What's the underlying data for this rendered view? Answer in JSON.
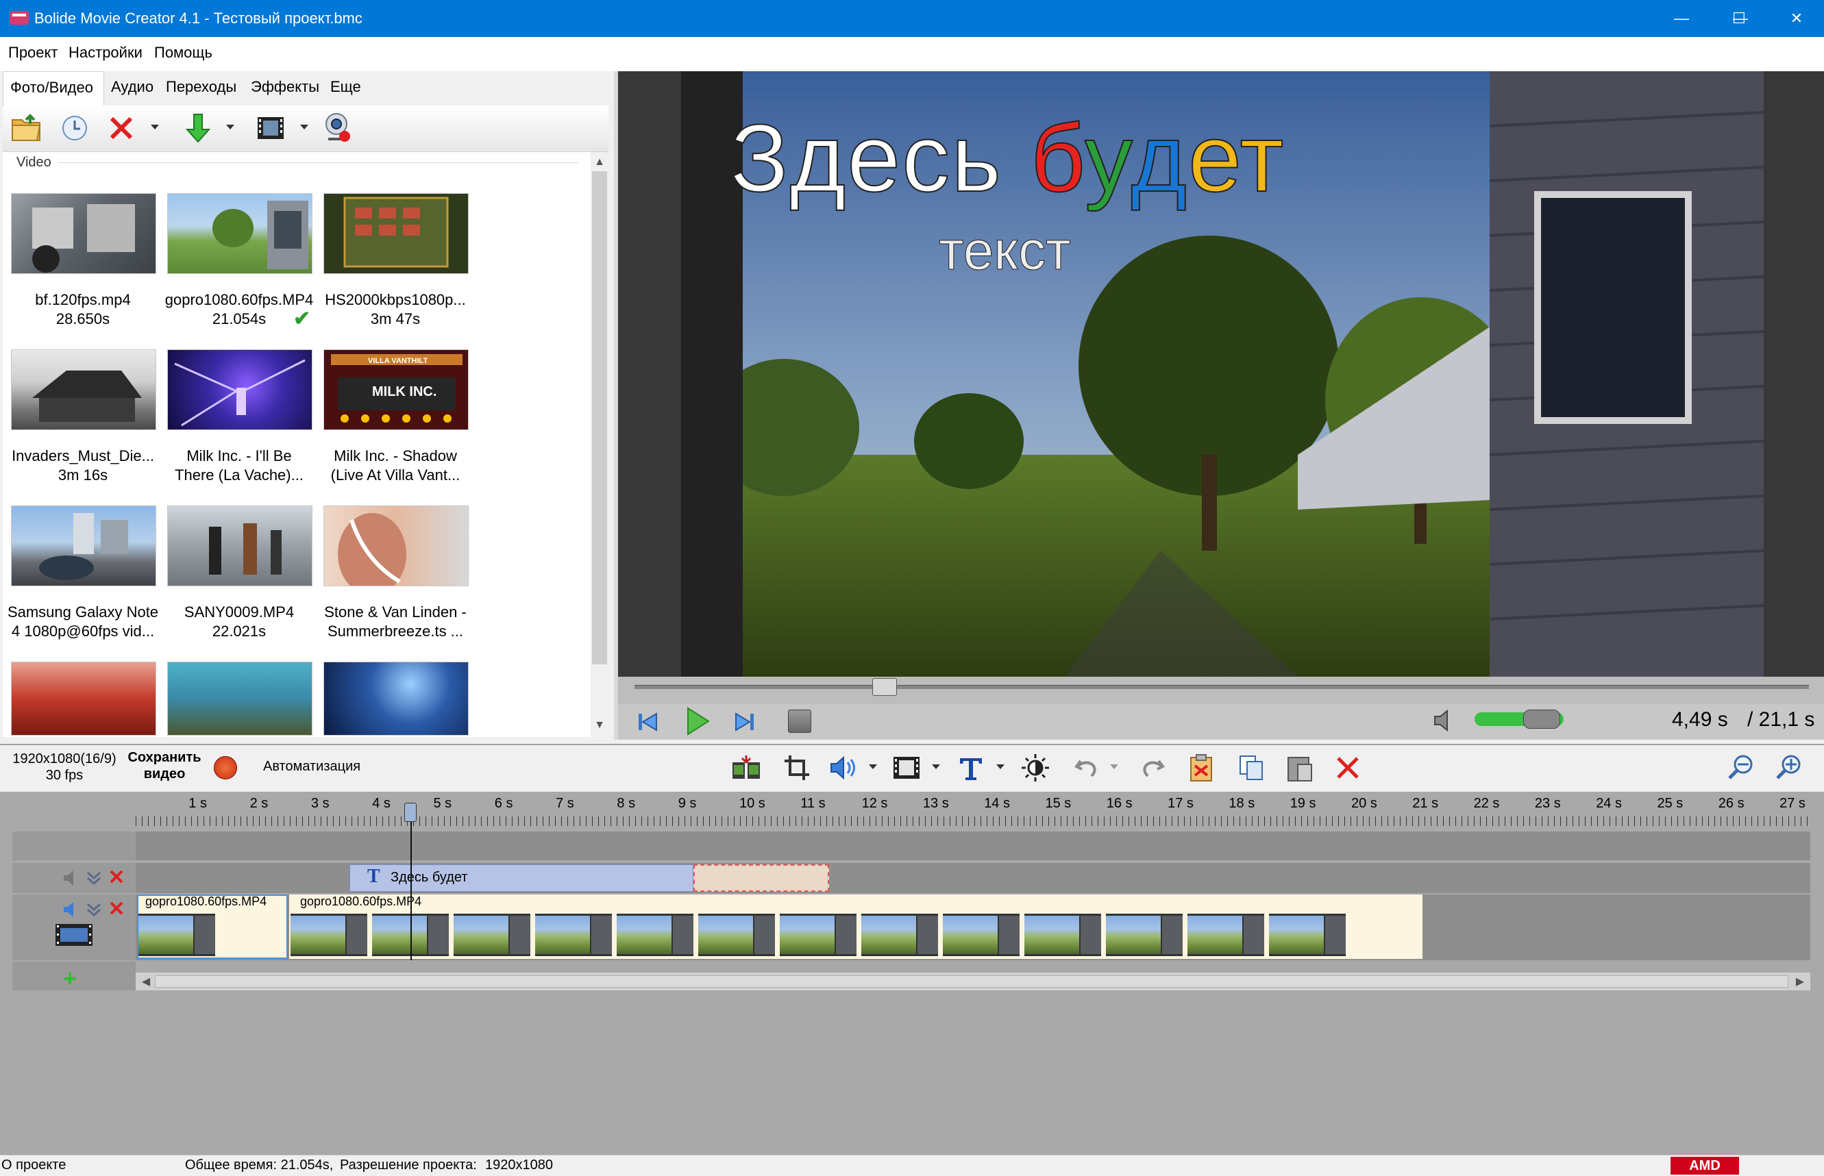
{
  "window": {
    "title": "Bolide Movie Creator 4.1 - Тестовый проект.bmc"
  },
  "menu": [
    "Проект",
    "Настройки",
    "Помощь"
  ],
  "tabs": [
    "Фото/Видео",
    "Аудио",
    "Переходы",
    "Эффекты",
    "Еще"
  ],
  "media": {
    "group_label": "Video",
    "items": [
      {
        "name": "bf.120fps.mp4",
        "sub": "28.650s"
      },
      {
        "name": "gopro1080.60fps.MP4",
        "sub": "21.054s",
        "check": "✔"
      },
      {
        "name": "HS2000kbps1080p...",
        "sub": "3m 47s"
      },
      {
        "name": "Invaders_Must_Die...",
        "sub": "3m 16s"
      },
      {
        "name": "Milk Inc.  - I'll Be",
        "sub": "There (La Vache)..."
      },
      {
        "name": "Milk Inc. - Shadow",
        "sub": "(Live At Villa Vant..."
      },
      {
        "name": "Samsung Galaxy Note",
        "sub": "4 1080p@60fps vid..."
      },
      {
        "name": "SANY0009.MP4",
        "sub": "22.021s"
      },
      {
        "name": "Stone & Van Linden -",
        "sub": "Summerbreeze.ts ..."
      },
      {
        "name": "",
        "sub": ""
      },
      {
        "name": "",
        "sub": ""
      },
      {
        "name": "",
        "sub": ""
      }
    ],
    "thumb_badges": {
      "milk_thumb_text": "VILLA VANTHILT",
      "milk_logo": "MILK INC."
    }
  },
  "preview": {
    "title_line1": [
      "Здесь ",
      "б",
      "у",
      "д",
      "е",
      "т"
    ],
    "title_line1_colors": [
      "#ffffff",
      "#e8231f",
      "#2a9d3a",
      "#1877d2",
      "#f2b81a",
      "#f2b81a"
    ],
    "title_line2": "текст",
    "time_current": "4,49 s",
    "time_total": "/ 21,1 s",
    "seek_fraction": 0.213,
    "volume_fraction": 0.85
  },
  "timeline_toolbar": {
    "resolution": "1920x1080(16/9)",
    "fps": "30 fps",
    "save_line1": "Сохранить",
    "save_line2": "видео",
    "automation": "Автоматизация"
  },
  "timeline": {
    "ruler_labels": [
      "1 s",
      "2 s",
      "3 s",
      "4 s",
      "5 s",
      "6 s",
      "7 s",
      "8 s",
      "9 s",
      "10 s",
      "11 s",
      "12 s",
      "13 s",
      "14 s",
      "15 s",
      "16 s",
      "17 s",
      "18 s",
      "19 s",
      "20 s",
      "21 s",
      "22 s",
      "23 s",
      "24 s",
      "25 s",
      "26 s",
      "27 s"
    ],
    "text_clip_label": "Здесь будет",
    "clip1_label": "gopro1080.60fps.MP4",
    "clip2_label": "gopro1080.60fps.MP4",
    "playhead_seconds": 4.49
  },
  "statusbar": {
    "about": "О проекте",
    "total_time": "Общее время: 21.054s,",
    "resolution_label": "Разрешение проекта:",
    "resolution_value": "1920x1080",
    "amd": "AMD"
  },
  "icons": {
    "open": "open-folder-icon",
    "history": "clock-icon",
    "delete": "delete-icon",
    "import": "import-arrow-icon",
    "film": "film-icon",
    "webcam": "webcam-icon",
    "accent": "#0078d7",
    "record": "#d84a1e",
    "delete_red": "#e02020"
  }
}
